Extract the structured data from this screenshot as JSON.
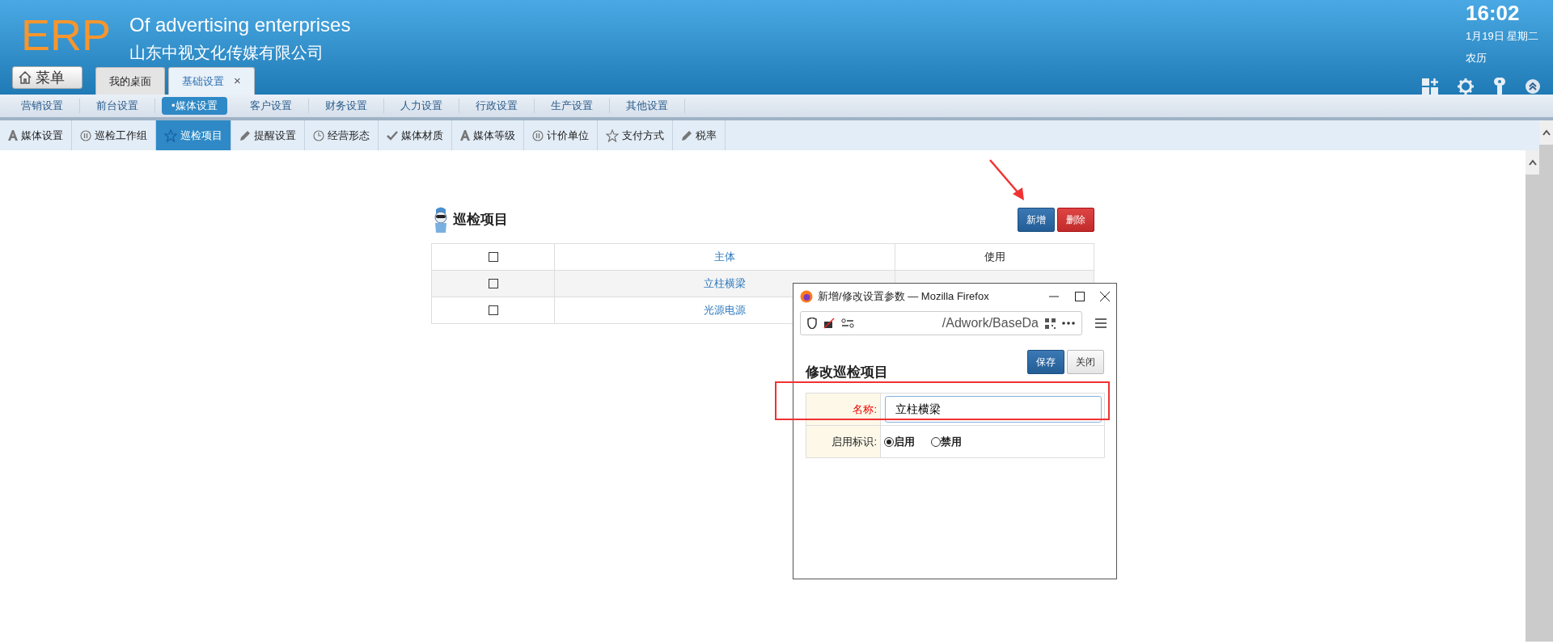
{
  "header": {
    "logo": "ERP",
    "title": "Of advertising enterprises",
    "company": "山东中视文化传媒有限公司",
    "menu_button": "菜单",
    "clock": {
      "time": "16:02",
      "date": "1月19日 星期二",
      "lunar": "农历"
    }
  },
  "tabs": [
    {
      "label": "我的桌面",
      "selected": false
    },
    {
      "label": "基础设置",
      "selected": true,
      "close": "×"
    }
  ],
  "categories": [
    {
      "label": "营销设置",
      "selected": false
    },
    {
      "label": "前台设置",
      "selected": false
    },
    {
      "label": "•媒体设置",
      "selected": true
    },
    {
      "label": "客户设置",
      "selected": false
    },
    {
      "label": "财务设置",
      "selected": false
    },
    {
      "label": "人力设置",
      "selected": false
    },
    {
      "label": "行政设置",
      "selected": false
    },
    {
      "label": "生产设置",
      "selected": false
    },
    {
      "label": "其他设置",
      "selected": false
    }
  ],
  "subtabs": [
    {
      "label": "媒体设置",
      "kind": "font",
      "selected": false
    },
    {
      "label": "巡检工作组",
      "kind": "pause",
      "selected": false
    },
    {
      "label": "巡检项目",
      "kind": "star",
      "selected": true
    },
    {
      "label": "提醒设置",
      "kind": "pencil",
      "selected": false
    },
    {
      "label": "经营形态",
      "kind": "clock",
      "selected": false
    },
    {
      "label": "媒体材质",
      "kind": "check",
      "selected": false
    },
    {
      "label": "媒体等级",
      "kind": "font",
      "selected": false
    },
    {
      "label": "计价单位",
      "kind": "pause",
      "selected": false
    },
    {
      "label": "支付方式",
      "kind": "star",
      "selected": false
    },
    {
      "label": "税率",
      "kind": "pencil",
      "selected": false
    }
  ],
  "page": {
    "title": "巡检项目",
    "buttons": [
      {
        "label": "新增",
        "kind": "primary"
      },
      {
        "label": "删除",
        "kind": "danger"
      }
    ],
    "table": {
      "header_checked": false,
      "columns": [
        "主体",
        "使用"
      ],
      "rows": [
        {
          "checked": false,
          "cells": [
            "立柱横梁"
          ]
        },
        {
          "checked": false,
          "cells": [
            "光源电源"
          ]
        }
      ]
    }
  },
  "dialog": {
    "window_title": "新增/修改设置参数 — Mozilla Firefox",
    "url": "/Adwork/BaseDa",
    "title": "修改巡检项目",
    "buttons": [
      {
        "label": "保存",
        "kind": "primary"
      },
      {
        "label": "关闭",
        "kind": "default"
      }
    ],
    "fields": [
      {
        "kind": "text",
        "label": "名称:",
        "required": true,
        "value": "立柱横梁",
        "highlighted": true
      },
      {
        "kind": "radio",
        "label": "启用标识:",
        "required": false,
        "options": [
          {
            "label": "启用",
            "selected": true
          },
          {
            "label": "禁用",
            "selected": false
          }
        ]
      }
    ]
  }
}
